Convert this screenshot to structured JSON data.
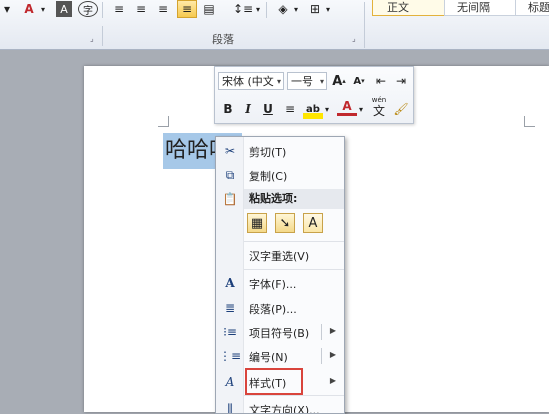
{
  "ribbon": {
    "paragraph_group_label": "段落",
    "style_normal": "正文",
    "style_no_spacing": "无间隔",
    "style_heading": "标题"
  },
  "document": {
    "selected_text": "哈哈哈"
  },
  "mini_toolbar": {
    "font_name": "宋体 (中文",
    "font_size": "一号",
    "bold": "B",
    "italic": "I",
    "underline": "U",
    "wen": "wén",
    "char": "文"
  },
  "context_menu": {
    "cut": "剪切(T)",
    "copy": "复制(C)",
    "paste_options": "粘贴选项:",
    "paste_text_only": "A",
    "hanzi_reconvert": "汉字重选(V)",
    "font": "字体(F)...",
    "paragraph": "段落(P)...",
    "bullets": "项目符号(B)",
    "numbering": "编号(N)",
    "styles": "样式(T)",
    "text_direction": "文字方向(X)..."
  },
  "colors": {
    "selection": "#a6c8e8",
    "highlight_box": "#d9443c"
  }
}
